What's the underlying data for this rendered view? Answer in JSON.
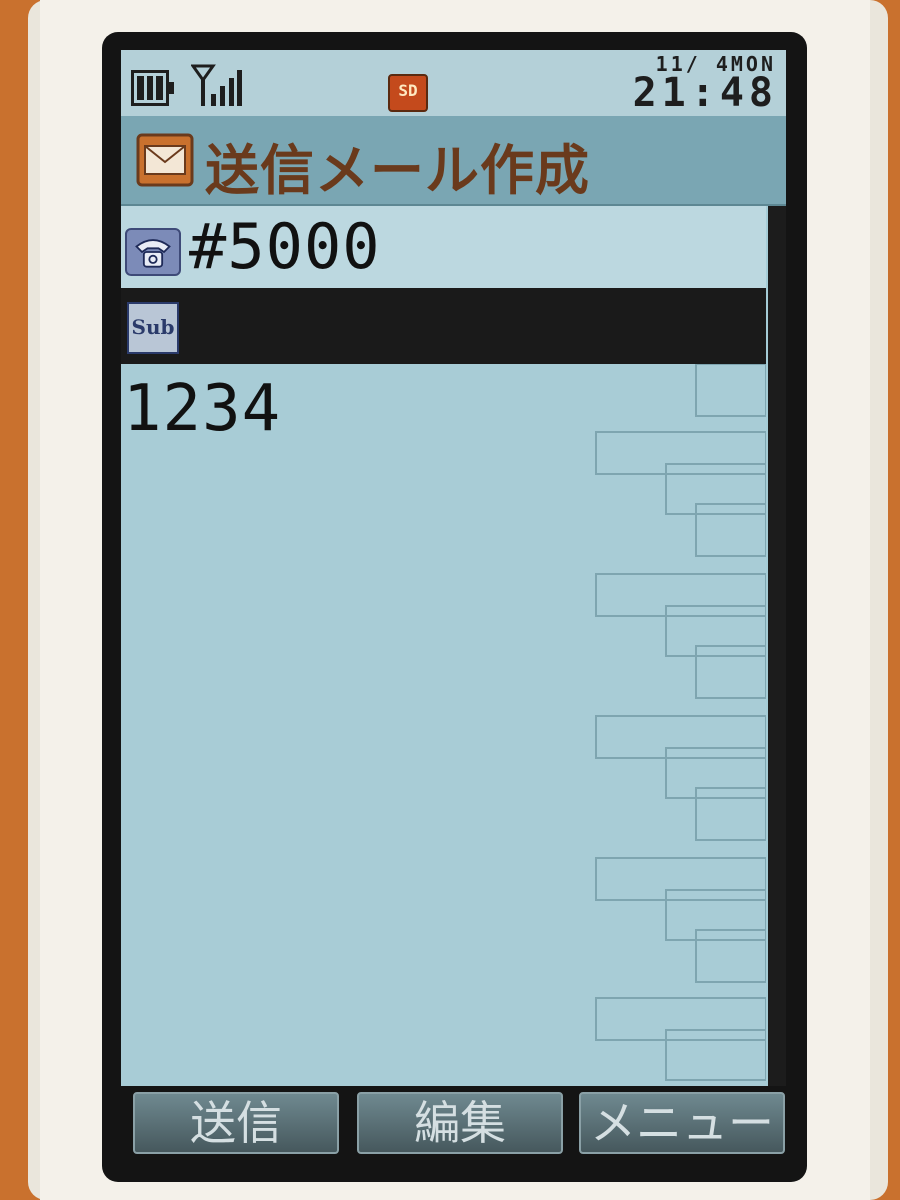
{
  "status_bar": {
    "date": "11/ 4MON",
    "time": "21:48",
    "sd_badge": "SD",
    "icons": [
      "battery-icon",
      "signal-antenna-icon",
      "sd-card-icon"
    ]
  },
  "header": {
    "title": "送信メール作成",
    "icon": "mail-compose-icon"
  },
  "compose": {
    "recipient": "#5000",
    "recipient_icon": "phone-icon",
    "subject_icon_label": "Sub",
    "subject": "",
    "body": "1234"
  },
  "softkeys": {
    "left": "送信",
    "center": "編集",
    "right": "メニュー"
  },
  "colors": {
    "screen_background": "#a5ccd6",
    "title_bar": "#7aa6b3",
    "title_text": "#6a3a1c",
    "selected_row": "#1a1a1a"
  }
}
